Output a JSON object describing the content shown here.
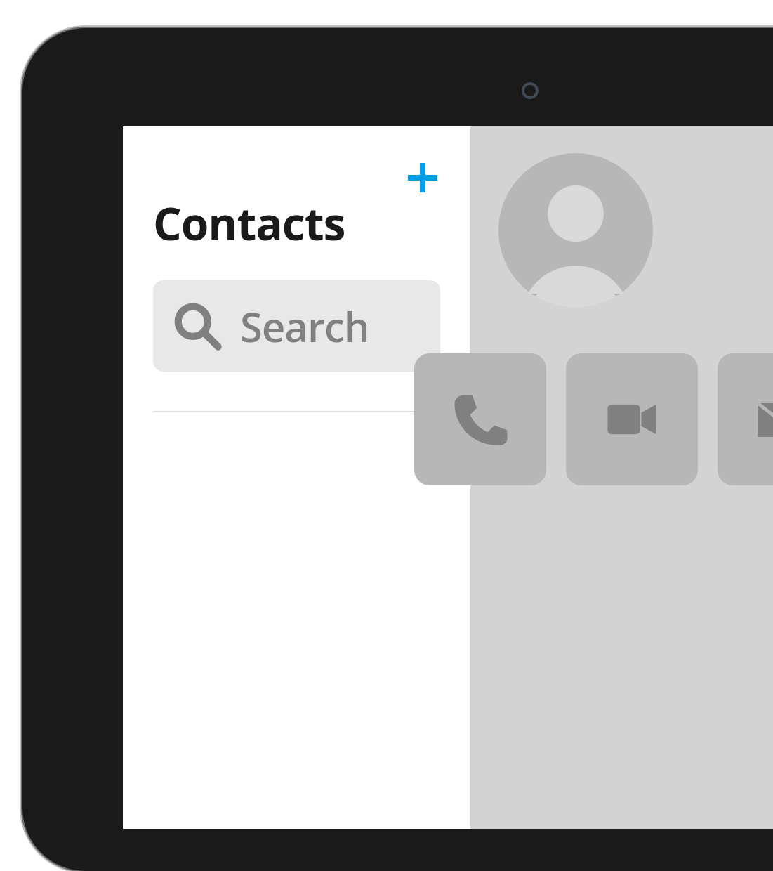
{
  "sidebar": {
    "title": "Contacts",
    "search_placeholder": "Search"
  },
  "colors": {
    "accent": "#009fe3",
    "icon_grey": "#808080",
    "tile_grey": "#b7b7b7",
    "avatar_bg": "#b7b7b7",
    "avatar_fg": "#d9d9d9"
  },
  "detail": {
    "actions": [
      {
        "name": "phone"
      },
      {
        "name": "video"
      },
      {
        "name": "mail"
      }
    ]
  }
}
